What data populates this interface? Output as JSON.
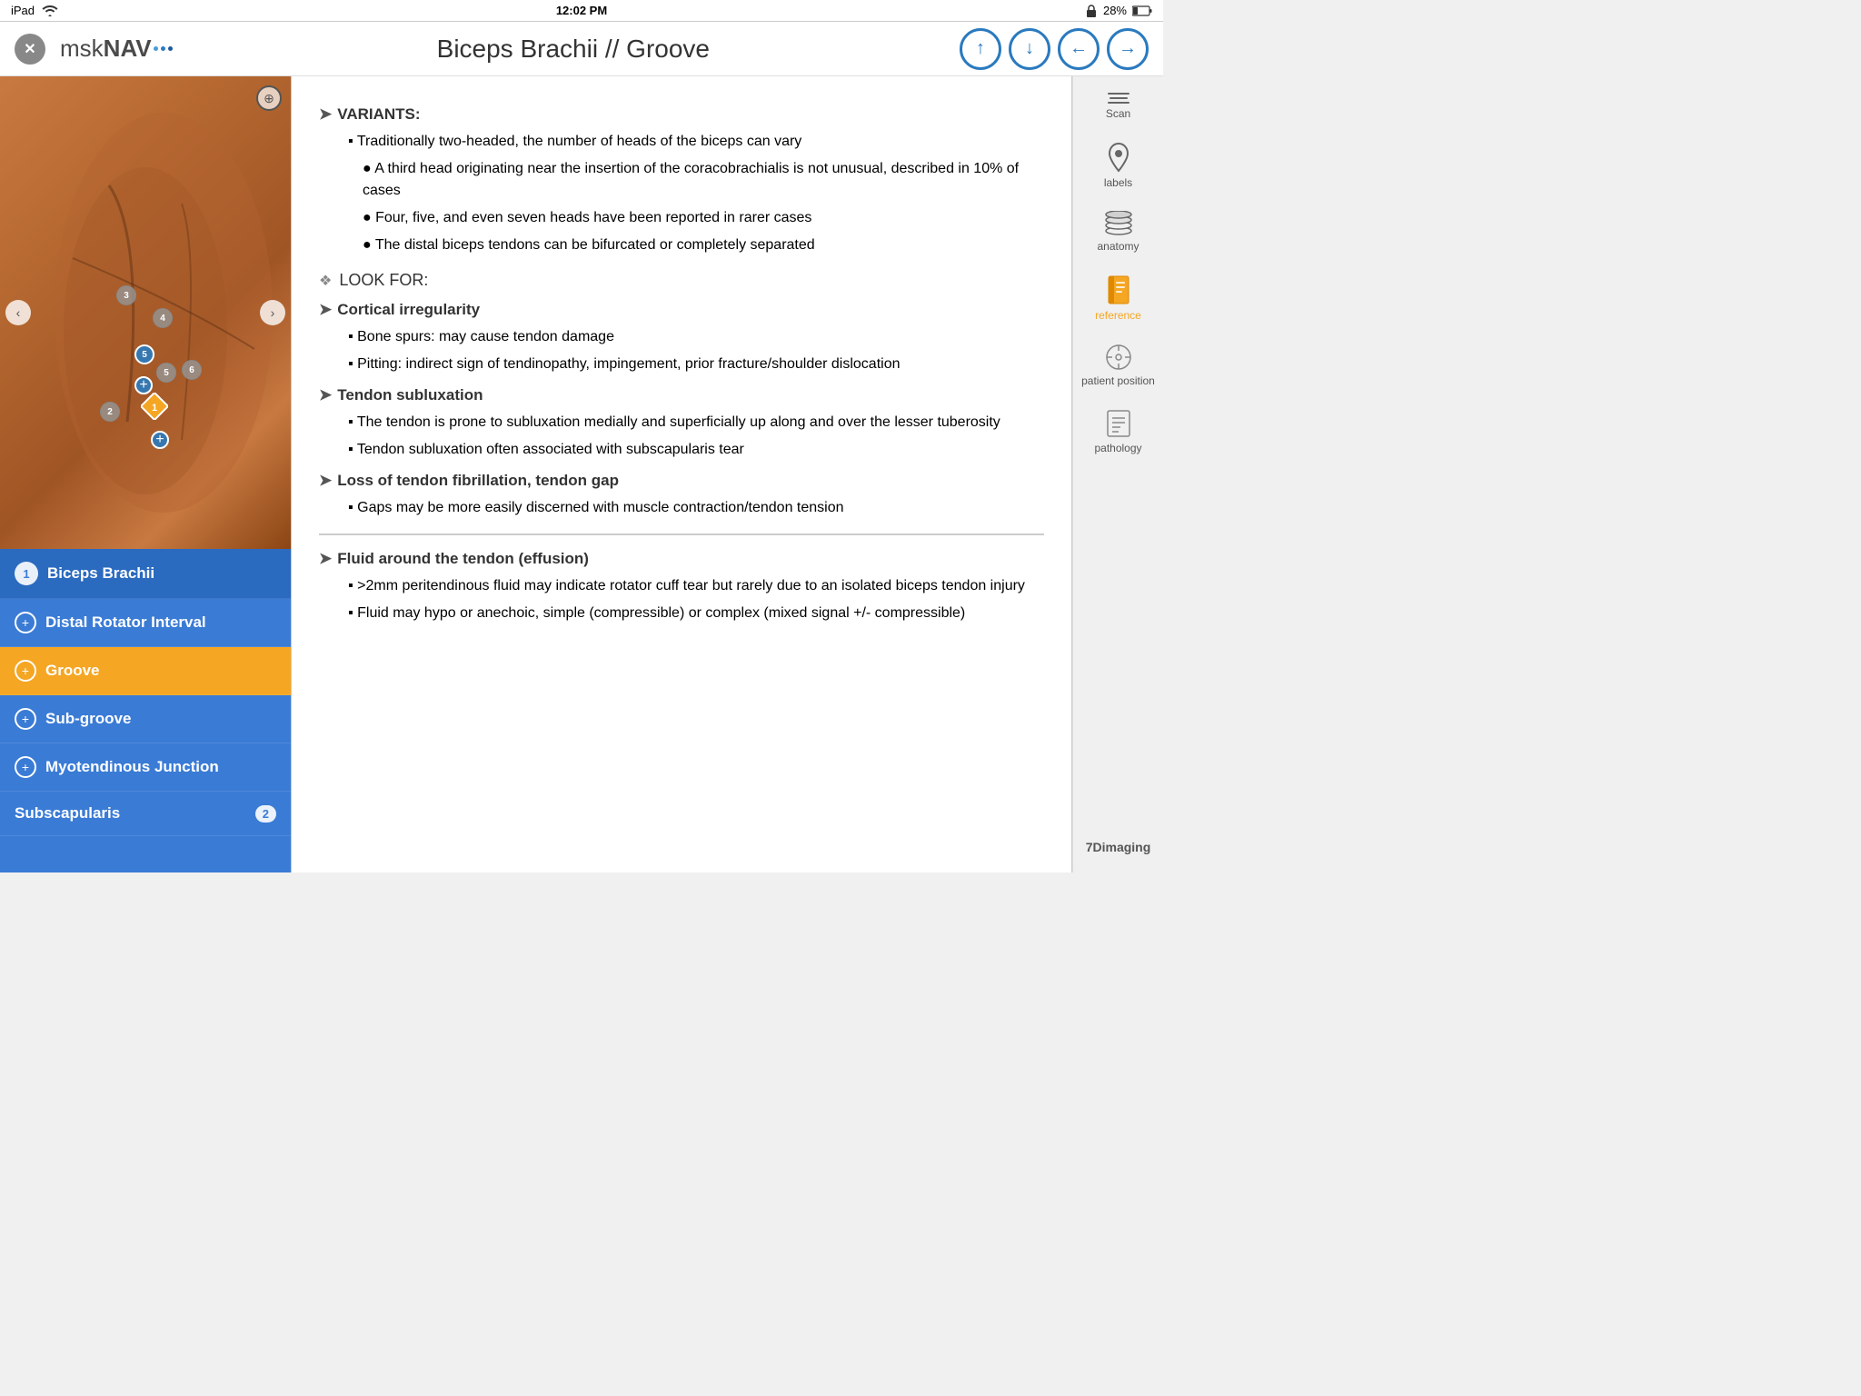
{
  "status_bar": {
    "left": "iPad",
    "time": "12:02 PM",
    "battery": "28%",
    "wifi_icon": "wifi-icon",
    "lock_icon": "lock-icon"
  },
  "header": {
    "close_label": "✕",
    "logo_prefix": "msk",
    "logo_suffix": "NAV",
    "page_title": "Biceps Brachii // Groove",
    "nav_up": "↑",
    "nav_down": "↓",
    "nav_back": "←",
    "nav_forward": "→"
  },
  "anatomy_image": {
    "zoom_icon": "+",
    "prev_icon": "‹",
    "next_icon": "›",
    "markers": [
      {
        "id": "m3",
        "label": "3"
      },
      {
        "id": "m4",
        "label": "4"
      },
      {
        "id": "m5a",
        "label": "5"
      },
      {
        "id": "m5b",
        "label": "5"
      },
      {
        "id": "m6",
        "label": "6"
      },
      {
        "id": "m2",
        "label": "2"
      },
      {
        "id": "m1",
        "label": "1"
      }
    ]
  },
  "nav_list": [
    {
      "id": "biceps-brachii",
      "label": "Biceps Brachii",
      "type": "numbered",
      "number": "1",
      "active": true
    },
    {
      "id": "distal-rotator",
      "label": "Distal Rotator Interval",
      "type": "plus",
      "active": false
    },
    {
      "id": "groove",
      "label": "Groove",
      "type": "plus",
      "active": false,
      "orange": true
    },
    {
      "id": "sub-groove",
      "label": "Sub-groove",
      "type": "plus",
      "active": false
    },
    {
      "id": "myotendinous",
      "label": "Myotendinous Junction",
      "type": "plus",
      "active": false
    },
    {
      "id": "subscapularis",
      "label": "Subscapularis",
      "type": "text",
      "badge": "2"
    }
  ],
  "content": {
    "sections": [
      {
        "type": "heading-arrow",
        "text": "VARIANTS:"
      },
      {
        "type": "bullet",
        "text": "Traditionally two-headed, the number of heads of the biceps can vary"
      },
      {
        "type": "circle-bullet",
        "text": "A third head originating near the insertion of the coracobrachialis is not unusual, described in 10% of cases"
      },
      {
        "type": "circle-bullet",
        "text": "Four, five, and even seven heads have been reported in rarer cases"
      },
      {
        "type": "circle-bullet",
        "text": "The distal biceps tendons can be bifurcated or completely separated"
      },
      {
        "type": "diamond",
        "text": "LOOK FOR:"
      },
      {
        "type": "heading-arrow",
        "text": "Cortical irregularity"
      },
      {
        "type": "bullet",
        "text": "Bone spurs: may cause tendon damage"
      },
      {
        "type": "bullet",
        "text": "Pitting: indirect sign of tendinopathy, impingement, prior fracture/shoulder dislocation"
      },
      {
        "type": "heading-arrow",
        "text": "Tendon subluxation"
      },
      {
        "type": "bullet",
        "text": "The tendon is prone to subluxation medially and superficially up along and over the lesser tuberosity"
      },
      {
        "type": "bullet",
        "text": "Tendon subluxation often associated with subscapularis tear"
      },
      {
        "type": "heading-arrow",
        "text": "Loss of tendon fibrillation, tendon gap"
      },
      {
        "type": "bullet",
        "text": "Gaps may be more easily discerned with muscle contraction/tendon tension"
      },
      {
        "type": "divider"
      },
      {
        "type": "heading-arrow",
        "text": "Fluid around the tendon (effusion)"
      },
      {
        "type": "bullet",
        "text": ">2mm peritendinous fluid may indicate rotator cuff tear  but rarely due to an isolated biceps tendon injury"
      },
      {
        "type": "bullet",
        "text": "Fluid may hypo or anechoic, simple (compressible) or complex (mixed signal +/- compressible)"
      }
    ]
  },
  "right_sidebar": [
    {
      "id": "scan",
      "label": "Scan",
      "icon": "menu-icon",
      "active": false
    },
    {
      "id": "labels",
      "label": "labels",
      "icon": "pin-icon",
      "active": false
    },
    {
      "id": "anatomy",
      "label": "anatomy",
      "icon": "layers-icon",
      "active": false
    },
    {
      "id": "reference",
      "label": "reference",
      "icon": "book-icon",
      "active": true
    },
    {
      "id": "patient-position",
      "label": "patient position",
      "icon": "compass-icon",
      "active": false
    },
    {
      "id": "pathology",
      "label": "pathology",
      "icon": "doc-icon",
      "active": false
    }
  ],
  "brand": "7Dimaging"
}
